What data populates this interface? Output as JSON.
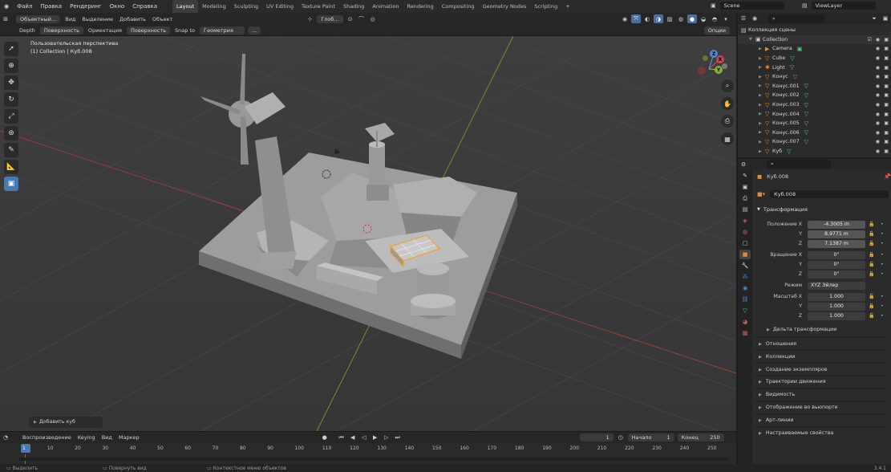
{
  "topbar": {
    "menus": [
      "Файл",
      "Правка",
      "Рендеринг",
      "Окно",
      "Справка"
    ],
    "workspaces": [
      "Layout",
      "Modeling",
      "Sculpting",
      "UV Editing",
      "Texture Paint",
      "Shading",
      "Animation",
      "Rendering",
      "Compositing",
      "Geometry Nodes",
      "Scripting"
    ],
    "active_workspace": "Layout",
    "add_tab": "+",
    "scene_label": "Scene",
    "viewlayer_label": "ViewLayer"
  },
  "viewport_header": {
    "mode": "Объектный...",
    "menus": [
      "Вид",
      "Выделение",
      "Добавить",
      "Объект"
    ],
    "transform_orientation": "Глоб...",
    "row2": {
      "depth_label": "Depth",
      "depth_value": "Поверхность",
      "orientation_label": "Ориентация",
      "orientation_value": "Поверхность",
      "snap_label": "Snap to",
      "snap_value": "Геометрия",
      "options_label": "Опции"
    }
  },
  "viewport": {
    "view_name": "Пользовательская перспектива",
    "active_object_info": "(1) Collection | Куб.008",
    "last_operator": "Добавить куб",
    "gizmo_axes": [
      "X",
      "Y",
      "Z"
    ]
  },
  "timeline": {
    "playback": "Воспроизведение",
    "keying": "Keying",
    "view": "Вид",
    "marker": "Маркер",
    "current_frame": "1",
    "start_label": "Начало",
    "start_value": "1",
    "end_label": "Конец",
    "end_value": "250",
    "ticks": [
      "1",
      "10",
      "20",
      "30",
      "40",
      "50",
      "60",
      "70",
      "80",
      "90",
      "100",
      "110",
      "120",
      "130",
      "140",
      "150",
      "160",
      "170",
      "180",
      "190",
      "200",
      "210",
      "220",
      "230",
      "240",
      "250"
    ]
  },
  "statusbar": {
    "select": "Выделить",
    "rotate": "Повернуть вид",
    "context": "Контекстное меню объектов",
    "version": "3.4.1"
  },
  "outliner": {
    "scene_collection": "Коллекция сцены",
    "collection": "Collection",
    "items": [
      {
        "name": "Camera",
        "type": "camera"
      },
      {
        "name": "Cube",
        "type": "mesh"
      },
      {
        "name": "Light",
        "type": "light"
      },
      {
        "name": "Конус",
        "type": "mesh"
      },
      {
        "name": "Конус.001",
        "type": "mesh"
      },
      {
        "name": "Конус.002",
        "type": "mesh"
      },
      {
        "name": "Конус.003",
        "type": "mesh"
      },
      {
        "name": "Конус.004",
        "type": "mesh"
      },
      {
        "name": "Конус.005",
        "type": "mesh"
      },
      {
        "name": "Конус.006",
        "type": "mesh"
      },
      {
        "name": "Конус.007",
        "type": "mesh"
      },
      {
        "name": "Куб",
        "type": "mesh"
      }
    ]
  },
  "properties": {
    "object_name": "Куб.008",
    "object_name_field": "Куб.008",
    "transform_panel": "Трансформация",
    "location_label": "Положение X",
    "location": [
      "-4.3005 m",
      "8.9771 m",
      "7.1387 m"
    ],
    "rotation_label": "Вращение X",
    "rotation": [
      "0°",
      "0°",
      "0°"
    ],
    "mode_label": "Режим",
    "mode_value": "XYZ Эйлер",
    "scale_label": "Масштаб X",
    "scale": [
      "1.000",
      "1.000",
      "1.000"
    ],
    "axis_y": "Y",
    "axis_z": "Z",
    "delta_transform": "Дельта трансформации",
    "panels": [
      "Отношения",
      "Коллекции",
      "Создание экземпляров",
      "Траектории движения",
      "Видимость",
      "Отображение во вьюпорте",
      "Арт-линии",
      "Настраиваемые свойства"
    ]
  },
  "colors": {
    "accent": "#4a78b0",
    "active_object_outline": "#f0a030",
    "x_axis": "#c8464c",
    "y_axis": "#86b23c",
    "z_axis": "#4f86d6"
  }
}
